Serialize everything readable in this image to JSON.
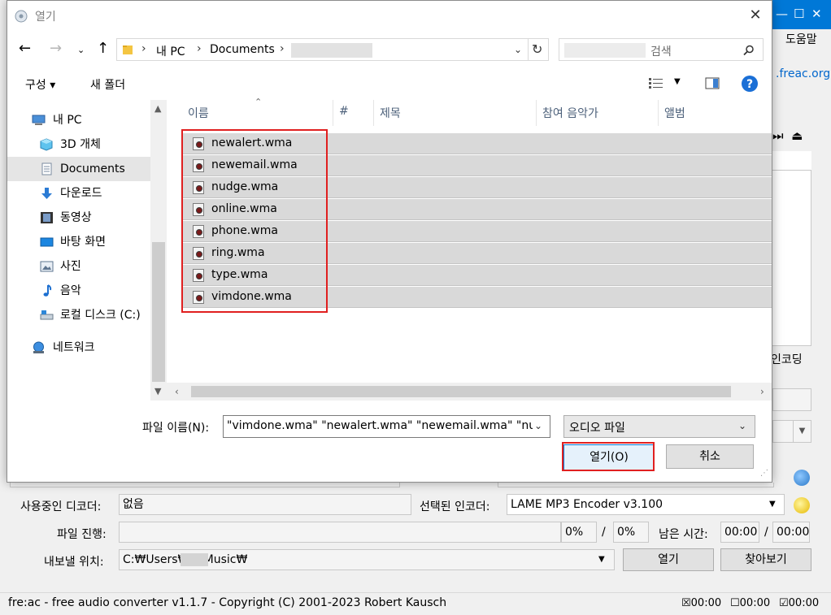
{
  "background_app": {
    "menu_help": "도움말",
    "website_link": ".freac.org",
    "encoding_tab": "인코딩",
    "fields": {
      "decoder_label": "사용중인 디코더:",
      "decoder_value": "없음",
      "encoder_label": "선택된 인코더:",
      "encoder_value": "LAME MP3 Encoder v3.100",
      "progress_label": "파일 진행:",
      "progress_percent": "0%",
      "progress_total_percent": "0%",
      "slash": "/",
      "remaining_label": "남은 시간:",
      "remaining_value": "00:00",
      "remaining_total": "00:00",
      "output_label": "내보낼 위치:",
      "output_path": "C:₩Users₩    ₩Music₩",
      "open_button": "열기",
      "browse_button": "찾아보기"
    },
    "status_bar": {
      "text": "fre:ac - free audio converter v1.1.7 - Copyright (C) 2001-2023 Robert Kausch",
      "timers": [
        "00:00",
        "00:00",
        "00:00"
      ]
    }
  },
  "dialog": {
    "title": "열기",
    "close_glyph": "✕",
    "address": {
      "crumbs": [
        "내 PC",
        "Documents"
      ],
      "search_placeholder": "검색"
    },
    "toolbar": {
      "organize": "구성 ▾",
      "new_folder": "새 폴더"
    },
    "nav_items": [
      {
        "label": "내 PC"
      },
      {
        "label": "3D 개체"
      },
      {
        "label": "Documents"
      },
      {
        "label": "다운로드"
      },
      {
        "label": "동영상"
      },
      {
        "label": "바탕 화면"
      },
      {
        "label": "사진"
      },
      {
        "label": "음악"
      },
      {
        "label": "로컬 디스크 (C:)"
      },
      {
        "label": "네트워크"
      }
    ],
    "columns": [
      "이름",
      "#",
      "제목",
      "참여 음악가",
      "앨범"
    ],
    "files": [
      "newalert.wma",
      "newemail.wma",
      "nudge.wma",
      "online.wma",
      "phone.wma",
      "ring.wma",
      "type.wma",
      "vimdone.wma"
    ],
    "filename_label": "파일 이름(N):",
    "filename_value": "\"vimdone.wma\" \"newalert.wma\" \"newemail.wma\" \"nudge.wma\"",
    "filetype_value": "오디오 파일",
    "open_button": "열기(O)",
    "cancel_button": "취소"
  },
  "colors": {
    "accent": "#0078d7",
    "highlight_box": "#e02020",
    "selected_row": "#d9d9d9"
  }
}
